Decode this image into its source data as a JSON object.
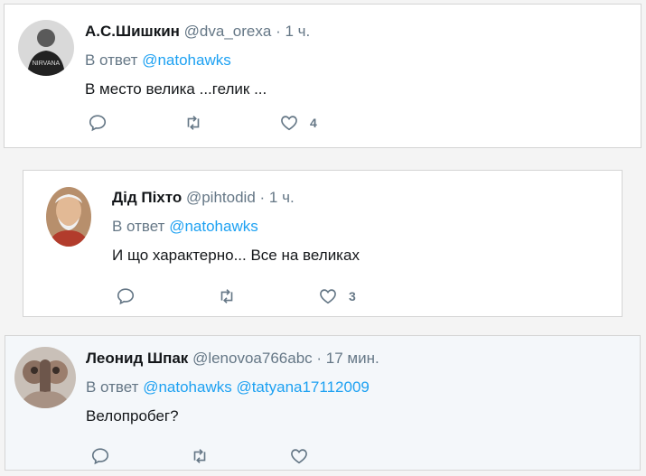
{
  "tweets": [
    {
      "name": "А.С.Шишкин",
      "handle": "@dva_orexa",
      "dot": "·",
      "time": "1 ч.",
      "reply_prefix": "В ответ",
      "reply_to": [
        "@natohawks"
      ],
      "text": "В место велика ...гелик ...",
      "likes": "4",
      "avatar_caption": "NIRVANA"
    },
    {
      "name": "Дід Піхто",
      "handle": "@pihtodid",
      "dot": "·",
      "time": "1 ч.",
      "reply_prefix": "В ответ",
      "reply_to": [
        "@natohawks"
      ],
      "text": "И що характерно... Все на великах",
      "likes": "3"
    },
    {
      "name": "Леонид Шпак",
      "handle": "@lenovoa766abc",
      "dot": "·",
      "time": "17 мин.",
      "reply_prefix": "В ответ",
      "reply_to": [
        "@natohawks",
        "@tatyana17112009"
      ],
      "text": "Велопробег?",
      "likes": ""
    }
  ],
  "icons": [
    "reply-icon",
    "retweet-icon",
    "like-icon"
  ],
  "colors": {
    "link": "#1da1f2",
    "muted": "#657786",
    "text": "#14171a"
  }
}
